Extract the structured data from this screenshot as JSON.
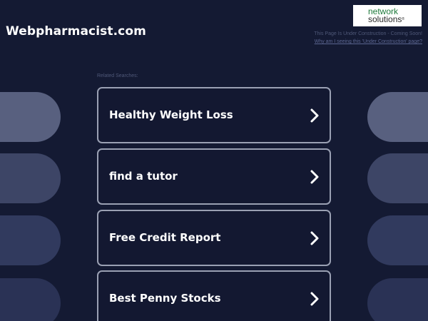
{
  "site": {
    "title": "Webpharmacist.com"
  },
  "logo": {
    "line1": "network",
    "line2": "solutions",
    "reg_mark": "®"
  },
  "construction": {
    "notice": "This Page Is Under Construction - Coming Soon!",
    "link": "Why am I seeing this 'Under Construction' page?"
  },
  "related": {
    "label": "Related Searches:",
    "items": [
      {
        "label": "Healthy Weight Loss"
      },
      {
        "label": "find a tutor"
      },
      {
        "label": "Free Credit Report"
      },
      {
        "label": "Best Penny Stocks"
      }
    ]
  },
  "colors": {
    "background": "#141a33",
    "card_border": "#9aa0b3",
    "pill_row_1": "#58607f",
    "pill_row_2": "#3d4566",
    "pill_row_3": "#313a5e",
    "pill_row_4": "#2a3255"
  },
  "icons": {
    "card_arrow": "chevron-right-icon"
  }
}
